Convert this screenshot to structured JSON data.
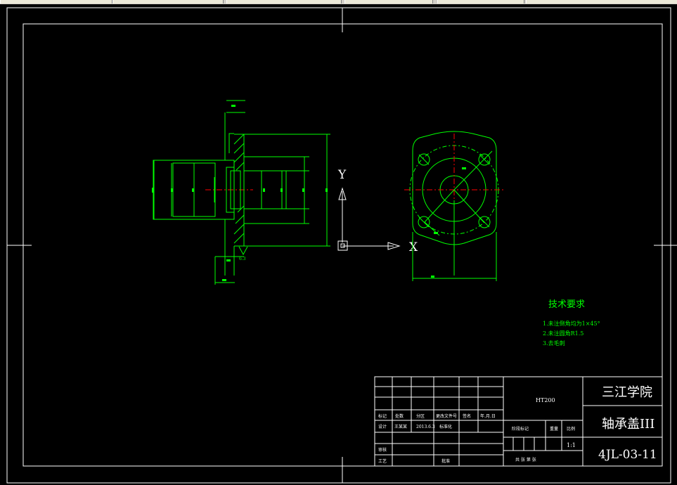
{
  "app": {
    "tab_count": 6
  },
  "drawing": {
    "background_color": "#000000",
    "outline_color": "#00ff00",
    "frame_color": "#ffffff",
    "centerline_color": "#ff0000"
  },
  "ucs": {
    "y_label": "Y",
    "x_label": "X"
  },
  "left_view": {
    "roughness_label": "6.3"
  },
  "technical_requirements": {
    "title": "技术要求",
    "items": [
      "1.未注倒角均为1×45°",
      "2.未注圆角R1.5",
      "3.去毛刺"
    ]
  },
  "title_block": {
    "material": "HT200",
    "school": "三江学院",
    "part_name": "轴承盖III",
    "drawing_number": "4JL-03-11",
    "scale": "1:1",
    "header_row": [
      "标记",
      "处数",
      "分区",
      "更改文件号",
      "签名",
      "年.月.日"
    ],
    "design_row": [
      "设计",
      "王某某",
      "2013.6.3",
      "标准化"
    ],
    "stage_labels": [
      "阶段标记",
      "重量",
      "比例"
    ],
    "review_label": "审核",
    "process_label": "工艺",
    "approve_label": "批准",
    "sheet_label": "共 张 第 张"
  }
}
